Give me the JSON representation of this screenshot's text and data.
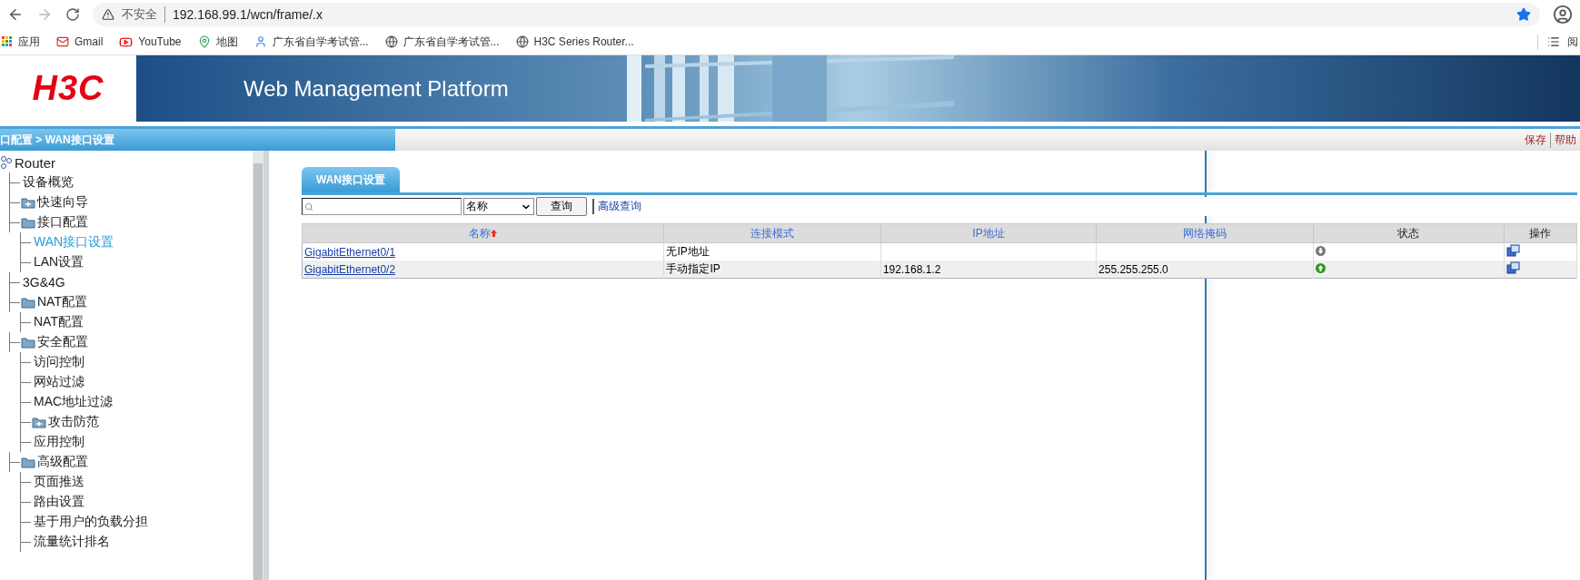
{
  "browser": {
    "security": "不安全",
    "url": "192.168.99.1/wcn/frame/.x",
    "bookmarks": [
      {
        "kind": "apps",
        "label": "应用"
      },
      {
        "kind": "gmail",
        "label": "Gmail"
      },
      {
        "kind": "youtube",
        "label": "YouTube"
      },
      {
        "kind": "maps",
        "label": "地图"
      },
      {
        "kind": "person",
        "label": "广东省自学考试管..."
      },
      {
        "kind": "globe",
        "label": "广东省自学考试管..."
      },
      {
        "kind": "globe",
        "label": "H3C Series Router..."
      }
    ],
    "reading_list": "阅"
  },
  "header": {
    "logo": "H3C",
    "title": "Web Management Platform"
  },
  "breadcrumb": {
    "path": "口配置 > WAN接口设置",
    "actions": [
      "保存",
      "帮助"
    ]
  },
  "sidebar": {
    "root": "Router",
    "items": [
      {
        "kind": "leaf",
        "label": "设备概览",
        "selected": false
      },
      {
        "kind": "folder",
        "label": "快速向导",
        "expanded": false,
        "selected": false
      },
      {
        "kind": "folder",
        "label": "接口配置",
        "expanded": true,
        "selected": false,
        "children": [
          {
            "kind": "leaf",
            "label": "WAN接口设置",
            "selected": true
          },
          {
            "kind": "leaf",
            "label": "LAN设置",
            "selected": false
          }
        ]
      },
      {
        "kind": "leaf",
        "label": "3G&4G",
        "selected": false
      },
      {
        "kind": "folder",
        "label": "NAT配置",
        "expanded": true,
        "selected": false,
        "children": [
          {
            "kind": "leaf",
            "label": "NAT配置",
            "selected": false
          }
        ]
      },
      {
        "kind": "folder",
        "label": "安全配置",
        "expanded": true,
        "selected": false,
        "children": [
          {
            "kind": "leaf",
            "label": "访问控制",
            "selected": false
          },
          {
            "kind": "leaf",
            "label": "网站过滤",
            "selected": false
          },
          {
            "kind": "leaf",
            "label": "MAC地址过滤",
            "selected": false
          },
          {
            "kind": "folder",
            "label": "攻击防范",
            "expanded": false,
            "selected": false
          },
          {
            "kind": "leaf",
            "label": "应用控制",
            "selected": false
          }
        ]
      },
      {
        "kind": "folder",
        "label": "高级配置",
        "expanded": true,
        "selected": false,
        "children": [
          {
            "kind": "leaf",
            "label": "页面推送",
            "selected": false
          },
          {
            "kind": "leaf",
            "label": "路由设置",
            "selected": false
          },
          {
            "kind": "leaf",
            "label": "基于用户的负载分担",
            "selected": false
          },
          {
            "kind": "leaf",
            "label": "流量统计排名",
            "selected": false
          }
        ]
      }
    ]
  },
  "tabs": [
    {
      "label": "WAN接口设置",
      "selected": true
    }
  ],
  "search": {
    "field": "名称",
    "button": "查询",
    "advanced": "高级查询"
  },
  "table": {
    "columns": [
      {
        "label": "名称",
        "sortable": true,
        "sorted": true
      },
      {
        "label": "连接模式",
        "sortable": true,
        "sorted": false
      },
      {
        "label": "IP地址",
        "sortable": true,
        "sorted": false
      },
      {
        "label": "网络掩码",
        "sortable": true,
        "sorted": false
      },
      {
        "label": "状态",
        "sortable": false,
        "sorted": false
      },
      {
        "label": "操作",
        "sortable": false,
        "sorted": false
      }
    ],
    "rows": [
      {
        "name": "GigabitEthernet0/1",
        "mode": "无IP地址",
        "up": false
      },
      {
        "name": "GigabitEthernet0/2",
        "mode": "手动指定IP",
        "ip": "192.168.1.2",
        "mask": "255.255.255.0",
        "up": true
      }
    ]
  }
}
